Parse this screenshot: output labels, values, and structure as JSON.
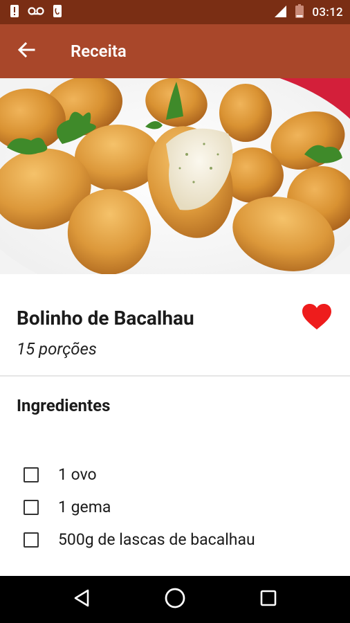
{
  "status_bar": {
    "time": "03:12",
    "icons": [
      "alert-icon",
      "voicemail-icon",
      "sim-icon",
      "signal-icon",
      "battery-icon"
    ]
  },
  "app_bar": {
    "title": "Receita",
    "back_icon": "arrow-left-icon",
    "background": "#a9472a"
  },
  "hero": {
    "subject": "bolinhos de bacalhau"
  },
  "recipe": {
    "title": "Bolinho de Bacalhau",
    "portions": "15 porções",
    "favorite": true,
    "favorite_color": "#ee1c1c"
  },
  "ingredients_section": {
    "title": "Ingredientes",
    "items": [
      {
        "label": "1 ovo",
        "checked": false
      },
      {
        "label": "1 gema",
        "checked": false
      },
      {
        "label": "500g de lascas de bacalhau",
        "checked": false
      }
    ]
  },
  "nav_bar": {
    "buttons": [
      "back-triangle-icon",
      "home-circle-icon",
      "recents-square-icon"
    ]
  }
}
